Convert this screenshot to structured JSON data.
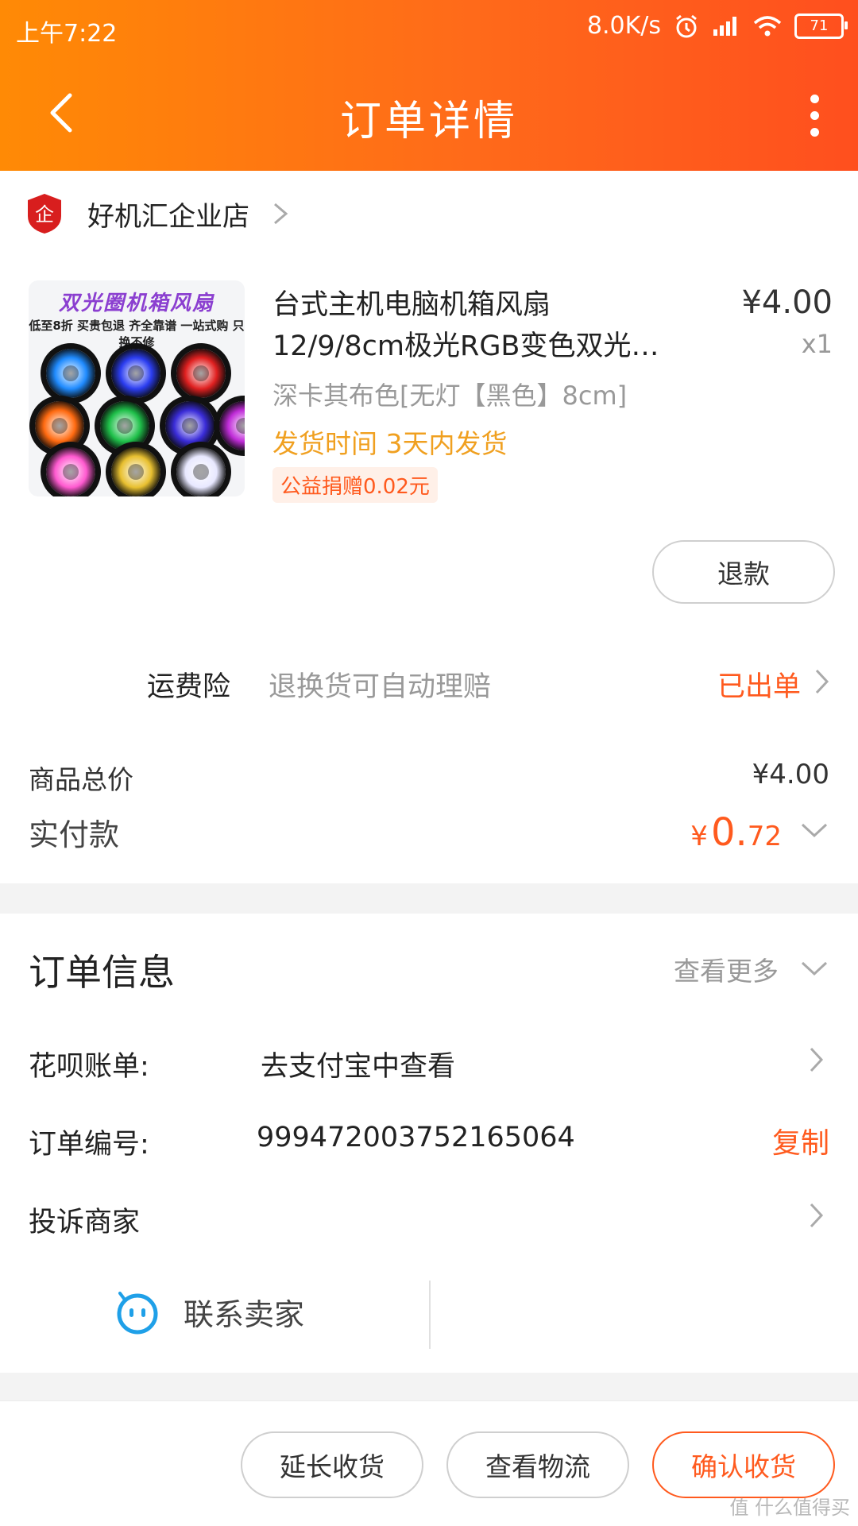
{
  "status_bar": {
    "time": "上午7:22",
    "speed": "8.0K/s",
    "battery": "71"
  },
  "navbar": {
    "title": "订单详情"
  },
  "store": {
    "name": "好机汇企业店",
    "badge_text": "企"
  },
  "product": {
    "image_title": "双光圈机箱风扇",
    "image_subtitle": "低至8折 买贵包退 齐全靠谱 一站式购 只换不修",
    "title_line1": "台式主机电脑机箱风扇",
    "title_line2": "12/9/8cm极光RGB变色双光…",
    "price": "¥4.00",
    "qty": "x1",
    "sku": "深卡其布色[无灯【黑色】8cm]",
    "ship_time": "发货时间 3天内发货",
    "charity": "公益捐赠0.02元",
    "fan_colors": [
      "#1f8bff",
      "#2b3df0",
      "#e02020",
      "#ff6a10",
      "#1fc04a",
      "#3a2cd8",
      "#c02cd8",
      "#ff5ad0",
      "#e8c030",
      "#e8e8ff"
    ]
  },
  "refund_button": "退款",
  "insurance": {
    "label": "运费险",
    "desc": "退换货可自动理赔",
    "status": "已出单"
  },
  "summary": {
    "total_label": "商品总价",
    "total_value": "¥4.00",
    "paid_label": "实付款",
    "paid_currency": "¥",
    "paid_int": "0.",
    "paid_dec": "72"
  },
  "order_info": {
    "title": "订单信息",
    "more": "查看更多",
    "huabei_label": "花呗账单:",
    "huabei_value": "去支付宝中查看",
    "order_no_label": "订单编号:",
    "order_no_value": "999472003752165064",
    "copy": "复制",
    "complain": "投诉商家",
    "contact": "联系卖家"
  },
  "bottom": {
    "extend": "延长收货",
    "logistics": "查看物流",
    "confirm": "确认收货"
  },
  "watermark": "值 什么值得买",
  "colors": {
    "accent": "#ff5a1e",
    "header_start": "#ff8a05",
    "header_end": "#ff4f1e"
  }
}
